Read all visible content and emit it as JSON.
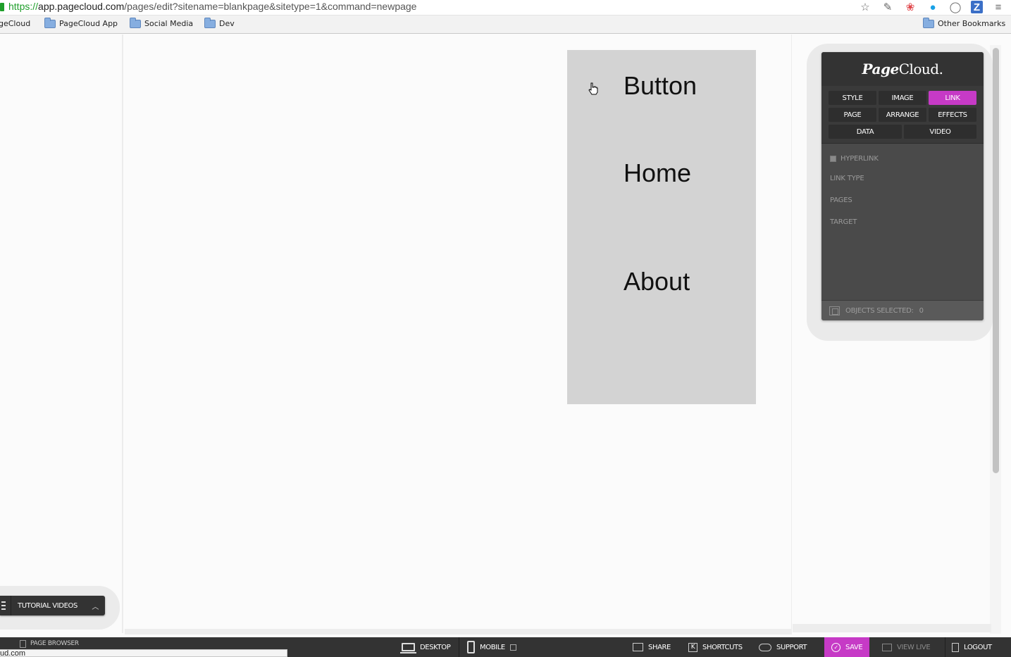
{
  "browser": {
    "url_scheme": "https://",
    "url_host": "app.pagecloud.com",
    "url_path": "/pages/edit?sitename=blankpage&sitetype=1&command=newpage",
    "bookmarks": [
      "geCloud",
      "PageCloud App",
      "Social Media",
      "Dev"
    ],
    "other_bookmarks": "Other Bookmarks",
    "status_text": "ud.com"
  },
  "canvas": {
    "menu_items": [
      "Button",
      "Home",
      "About"
    ],
    "menu_background": "#d3d3d3"
  },
  "panel": {
    "logo_bold": "Page",
    "logo_rest": "Cloud.",
    "tabs": [
      "STYLE",
      "IMAGE",
      "LINK",
      "PAGE",
      "ARRANGE",
      "EFFECTS",
      "DATA",
      "VIDEO"
    ],
    "active_tab": "LINK",
    "fields": {
      "hyperlink": "HYPERLINK",
      "link_type": "LINK TYPE",
      "pages": "PAGES",
      "target": "TARGET"
    },
    "objects_selected_label": "OBJECTS SELECTED:",
    "objects_selected_count": "0",
    "accent_color": "#c63ac6"
  },
  "tutorial": {
    "label": "TUTORIAL VIDEOS"
  },
  "bottombar": {
    "page_browser": "PAGE BROWSER",
    "desktop": "DESKTOP",
    "mobile": "MOBILE",
    "share": "SHARE",
    "shortcuts": "SHORTCUTS",
    "support": "SUPPORT",
    "save": "SAVE",
    "view_live": "VIEW LIVE",
    "logout": "LOGOUT"
  }
}
